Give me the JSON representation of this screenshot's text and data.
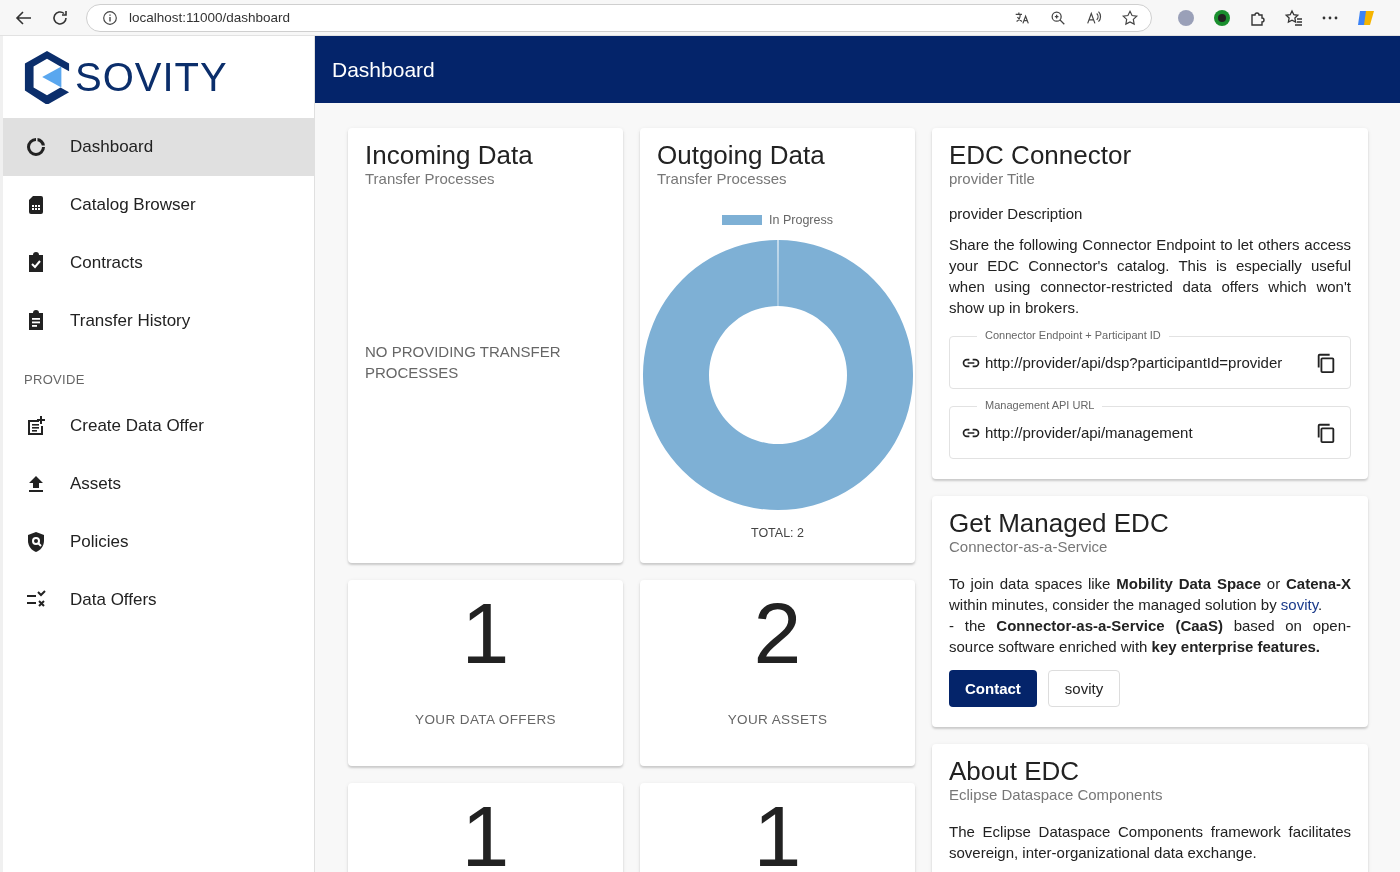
{
  "browser": {
    "url": "localhost:11000/dashboard"
  },
  "logo": {
    "text": "SOVITY"
  },
  "header": {
    "title": "Dashboard"
  },
  "sidebar": {
    "groups": [
      {
        "items": [
          {
            "label": "Dashboard",
            "selected": true
          },
          {
            "label": "Catalog Browser",
            "selected": false
          },
          {
            "label": "Contracts",
            "selected": false
          },
          {
            "label": "Transfer History",
            "selected": false
          }
        ]
      },
      {
        "heading": "PROVIDE",
        "items": [
          {
            "label": "Create Data Offer",
            "selected": false
          },
          {
            "label": "Assets",
            "selected": false
          },
          {
            "label": "Policies",
            "selected": false
          },
          {
            "label": "Data Offers",
            "selected": false
          }
        ]
      }
    ]
  },
  "incoming": {
    "title": "Incoming Data",
    "subtitle": "Transfer Processes",
    "empty_text": "NO PROVIDING TRANSFER PROCESSES"
  },
  "outgoing": {
    "title": "Outgoing Data",
    "subtitle": "Transfer Processes",
    "total": "TOTAL: 2",
    "legend": [
      {
        "label": "In Progress",
        "color": "#7eb0d5"
      }
    ]
  },
  "stats": [
    {
      "value": "1",
      "label": "YOUR DATA OFFERS"
    },
    {
      "value": "2",
      "label": "YOUR ASSETS"
    },
    {
      "value": "1"
    },
    {
      "value": "1"
    }
  ],
  "connector": {
    "title": "EDC Connector",
    "subtitle": "provider Title",
    "description": "provider Description",
    "text": "Share the following Connector Endpoint to let others access your EDC Connector's catalog. This is especially useful when using connector-restricted data offers which won't show up in brokers.",
    "fields": [
      {
        "label": "Connector Endpoint + Participant ID",
        "value": "http://provider/api/dsp?participantId=provider"
      },
      {
        "label": "Management API URL",
        "value": "http://provider/api/management"
      }
    ]
  },
  "managed": {
    "title": "Get Managed EDC",
    "subtitle": "Connector-as-a-Service",
    "text_before": "To join data spaces like **Mobility Data Space** or **Catena-X** within minutes, consider the managed solution by ",
    "link": "sovity",
    "text_after": ".",
    "text_line2": "- the **Connector-as-a-Service (CaaS)** based on open-source software enriched with **key enterprise features.**",
    "buttons": [
      {
        "label": "Contact",
        "kind": "primary"
      },
      {
        "label": "sovity",
        "kind": "outlined"
      }
    ]
  },
  "about": {
    "title": "About EDC",
    "subtitle": "Eclipse Dataspace Components",
    "text": "The Eclipse Dataspace Components framework facilitates sovereign, inter-organizational data exchange."
  }
}
